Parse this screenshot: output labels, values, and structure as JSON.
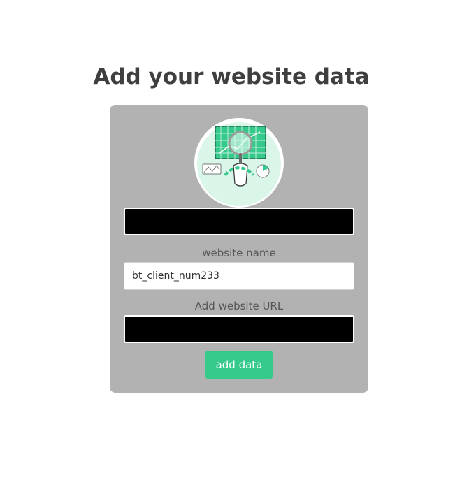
{
  "page": {
    "title": "Add your website data"
  },
  "form": {
    "illustration_icon": "analytics-magnifier-illustration",
    "website_name_label": "website name",
    "website_name_value": "bt_client_num233",
    "website_url_label": "Add website URL",
    "submit_label": "add data"
  },
  "colors": {
    "card_background": "#b2b2b2",
    "accent_green": "#35c98c",
    "title_text": "#3f3f3f",
    "redaction": "#000000"
  }
}
